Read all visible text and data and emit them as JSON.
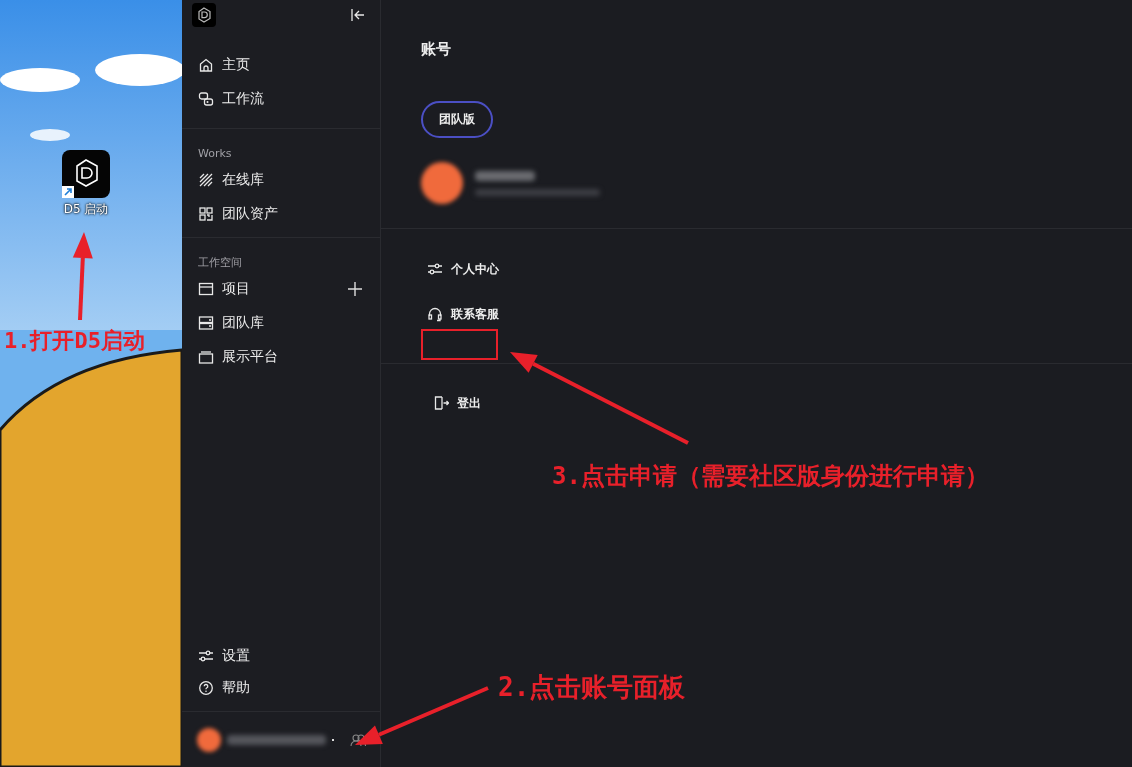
{
  "desktop": {
    "shortcut": {
      "label": "D5 启动"
    }
  },
  "sidebar": {
    "nav": [
      {
        "label": "主页",
        "kind": "home"
      },
      {
        "label": "工作流",
        "kind": "flow"
      }
    ],
    "sections": [
      {
        "title": "Works",
        "items": [
          {
            "label": "在线库",
            "kind": "hatch",
            "add": false
          },
          {
            "label": "团队资产",
            "kind": "grid",
            "add": false
          }
        ]
      },
      {
        "title": "工作空间",
        "items": [
          {
            "label": "项目",
            "kind": "panel",
            "add": true
          },
          {
            "label": "团队库",
            "kind": "stack",
            "add": false
          },
          {
            "label": "展示平台",
            "kind": "tray",
            "add": false
          }
        ]
      }
    ],
    "bottom": [
      {
        "label": "设置",
        "kind": "sliders"
      },
      {
        "label": "帮助",
        "kind": "help"
      }
    ]
  },
  "account_panel": {
    "title": "账号",
    "plan_badge": "团队版",
    "menu": [
      {
        "label": "个人中心",
        "kind": "sliders"
      },
      {
        "label": "联系客服",
        "kind": "headset"
      }
    ],
    "logout": {
      "label": "登出",
      "kind": "exit"
    }
  },
  "annotations": [
    {
      "text": "1.打开D5启动"
    },
    {
      "text": "3.点击申请（需要社区版身份进行申请）"
    },
    {
      "text": "2.点击账号面板"
    }
  ]
}
